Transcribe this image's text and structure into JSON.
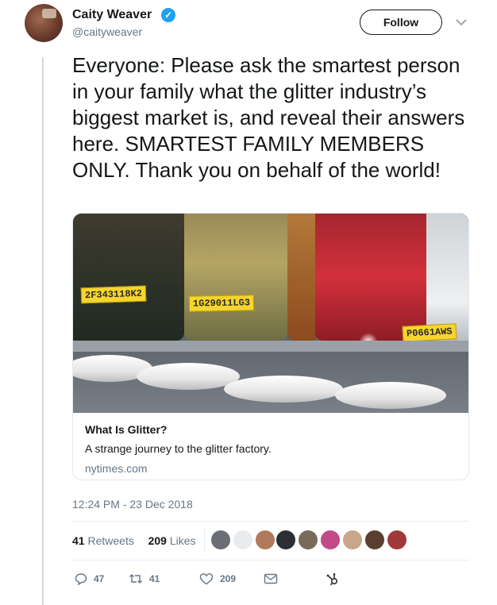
{
  "author": {
    "display_name": "Caity Weaver",
    "handle": "@caityweaver",
    "verified_icon": "verified-check-icon"
  },
  "header": {
    "follow_label": "Follow",
    "menu_icon": "chevron-down-icon"
  },
  "tweet": {
    "text": "Everyone: Please ask the smartest person in your family what the glitter industry’s biggest market is, and reveal their answers here. SMARTEST FAMILY MEMBERS ONLY. Thank you on behalf of the world!"
  },
  "card": {
    "image_labels": [
      "2F343118K2",
      "1G29011LG3",
      "P0661AWS"
    ],
    "title": "What Is Glitter?",
    "description": "A strange journey to the glitter factory.",
    "domain": "nytimes.com"
  },
  "timestamp": "12:24 PM - 23 Dec 2018",
  "stats": {
    "retweets_count": "41",
    "retweets_label": "Retweets",
    "likes_count": "209",
    "likes_label": "Likes"
  },
  "actions": {
    "reply_count": "47",
    "retweet_count": "41",
    "like_count": "209"
  },
  "colors": {
    "link_blue": "#1da1f2",
    "text_primary": "#14171a",
    "text_secondary": "#657786",
    "glitter_label_yellow": "#f7d52c"
  }
}
